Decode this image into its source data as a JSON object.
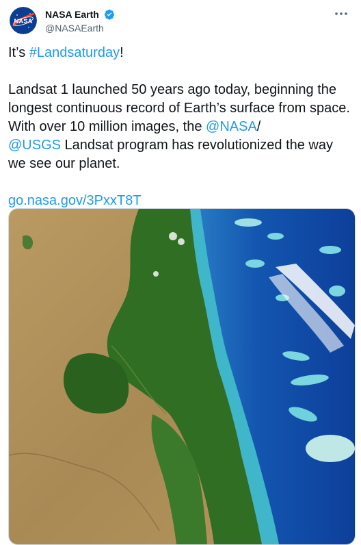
{
  "author": {
    "display_name": "NASA Earth",
    "handle": "@NASAEarth",
    "verified": true,
    "avatar_icon": "nasa-meatball-logo",
    "avatar_text": "NASA"
  },
  "tweet": {
    "line1_prefix": "It’s ",
    "line1_hashtag": "#Landsaturday",
    "line1_suffix": "!",
    "para2_part1": "Landsat 1 launched 50 years ago today, beginning the longest continuous record of Earth’s surface from space. With over 10 million images, the ",
    "mention1": "@NASA",
    "slash": "/",
    "mention2": "@USGS",
    "para2_part2": " Landsat program has revolutionized the way we see our planet.",
    "link": "go.nasa.gov/3PxxT8T"
  },
  "media": {
    "description_icon": "satellite-image-coast-reef"
  },
  "colors": {
    "link": "#1d9bf0",
    "text": "#0f1419",
    "secondary": "#536471",
    "verified": "#1d9bf0"
  }
}
